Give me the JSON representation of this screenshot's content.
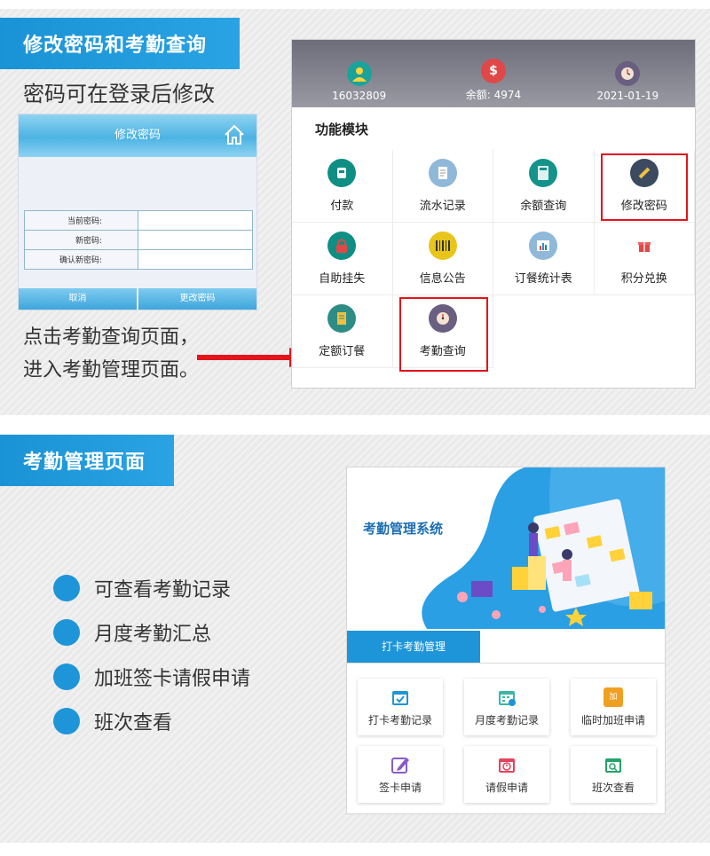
{
  "section1": {
    "banner": "修改密码和考勤查询",
    "caption": "密码可在登录后修改",
    "password_screen": {
      "title": "修改密码",
      "fields": [
        "当前密码:",
        "新密码:",
        "确认新密码:"
      ],
      "cancel": "取消",
      "submit": "更改密码"
    },
    "note_line1": "点击考勤查询页面，",
    "note_line2": "进入考勤管理页面。",
    "phone": {
      "user_id": "16032809",
      "balance": "余额: 4974",
      "date": "2021-01-19",
      "module_title": "功能模块",
      "modules": [
        {
          "label": "付款",
          "icon": "payment-icon",
          "color": "#0f8f84"
        },
        {
          "label": "流水记录",
          "icon": "notes-icon",
          "color": "#8fb8d9"
        },
        {
          "label": "余额查询",
          "icon": "calculator-icon",
          "color": "#13938a"
        },
        {
          "label": "修改密码",
          "icon": "pencil-icon",
          "color": "#3b4a5f"
        },
        {
          "label": "自助挂失",
          "icon": "lock-icon",
          "color": "#0f8f84"
        },
        {
          "label": "信息公告",
          "icon": "barcode-icon",
          "color": "#e7c51b"
        },
        {
          "label": "订餐统计表",
          "icon": "chart-icon",
          "color": "#8fb8d9"
        },
        {
          "label": "积分兑换",
          "icon": "gift-icon",
          "color": "#ffffff"
        },
        {
          "label": "定额订餐",
          "icon": "notebook-icon",
          "color": "#2d8d85"
        },
        {
          "label": "考勤查询",
          "icon": "clock-icon",
          "color": "#6a5f80"
        }
      ]
    }
  },
  "section2": {
    "banner": "考勤管理页面",
    "bullets": [
      "可查看考勤记录",
      "月度考勤汇总",
      "加班签卡请假申请",
      "班次查看"
    ],
    "app": {
      "title": "考勤管理系统",
      "tab": "打卡考勤管理",
      "cards": [
        {
          "label": "打卡考勤记录",
          "icon": "calendar-check-icon",
          "color": "#1e95d9"
        },
        {
          "label": "月度考勤记录",
          "icon": "calendar-grid-icon",
          "color": "#3bb6a3"
        },
        {
          "label": "临时加班申请",
          "icon": "calendar-plus-icon",
          "color": "#f0a020"
        },
        {
          "label": "签卡申请",
          "icon": "edit-icon",
          "color": "#8a5cc7"
        },
        {
          "label": "请假申请",
          "icon": "calendar-clock-icon",
          "color": "#e5445c"
        },
        {
          "label": "班次查看",
          "icon": "calendar-search-icon",
          "color": "#24a36a"
        }
      ],
      "overtime_badge": "加"
    }
  }
}
